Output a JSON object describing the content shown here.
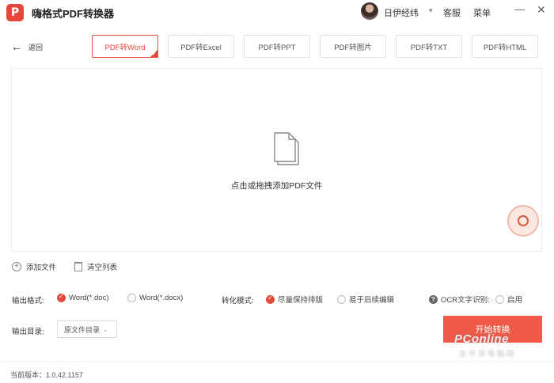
{
  "app": {
    "logo_letter": "P",
    "title": "嗨格式PDF转换器",
    "brand_color": "#e24a3d"
  },
  "header": {
    "username": "日伊经纬",
    "service_label": "客服",
    "menu_label": "菜单",
    "minimize_glyph": "—",
    "close_glyph": "✕"
  },
  "toolbar": {
    "back_label": "返回",
    "tabs": [
      {
        "label": "PDF转Word",
        "active": true
      },
      {
        "label": "PDF转Excel",
        "active": false
      },
      {
        "label": "PDF转PPT",
        "active": false
      },
      {
        "label": "PDF转图片",
        "active": false
      },
      {
        "label": "PDF转TXT",
        "active": false
      },
      {
        "label": "PDF转HTML",
        "active": false
      }
    ]
  },
  "dropzone": {
    "text": "点击或拖拽添加PDF文件",
    "icon": "document-stack-icon"
  },
  "actions": {
    "add_file": "添加文件",
    "clear_list": "清空列表"
  },
  "options": {
    "output_format_label": "输出格式:",
    "formats": [
      {
        "label": "Word(*.doc)",
        "checked": true
      },
      {
        "label": "Word(*.docx)",
        "checked": false
      }
    ],
    "convert_mode_label": "转化模式:",
    "modes": [
      {
        "label": "尽量保持排版",
        "checked": true
      },
      {
        "label": "易于后续编辑",
        "checked": false
      }
    ],
    "ocr_label": "OCR文字识别:",
    "ocr_option": {
      "label": "启用",
      "checked": false
    }
  },
  "output_dir": {
    "label": "输出目录:",
    "selected": "原文件目录"
  },
  "start_button": {
    "label": "开始转换"
  },
  "watermark": {
    "main": "PConline",
    "sub": "太平洋电脑网"
  },
  "footer": {
    "version_label": "当前版本：1.0.42.1157"
  }
}
